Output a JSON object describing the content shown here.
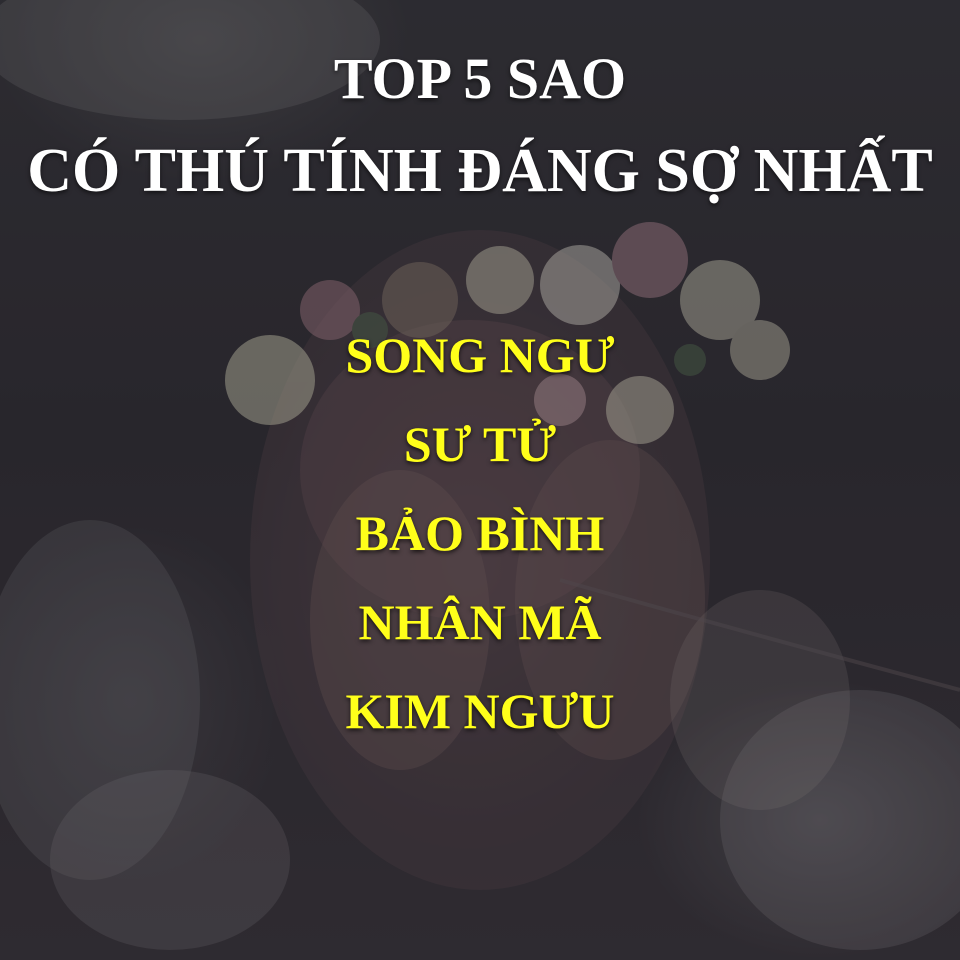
{
  "title": {
    "line1": "TOP  5 SAO",
    "line2": "CÓ THÚ TÍNH ĐÁNG SỢ NHẤT"
  },
  "signs": [
    "SONG NGƯ",
    "SƯ TỬ",
    "BẢO BÌNH",
    "NHÂN MÃ",
    "KIM NGƯU"
  ],
  "colors": {
    "title_text": "#ffffff",
    "sign_text": "#ffff1a",
    "background_dark": "#343238"
  },
  "background": {
    "icon": "flower-crown-photo"
  }
}
